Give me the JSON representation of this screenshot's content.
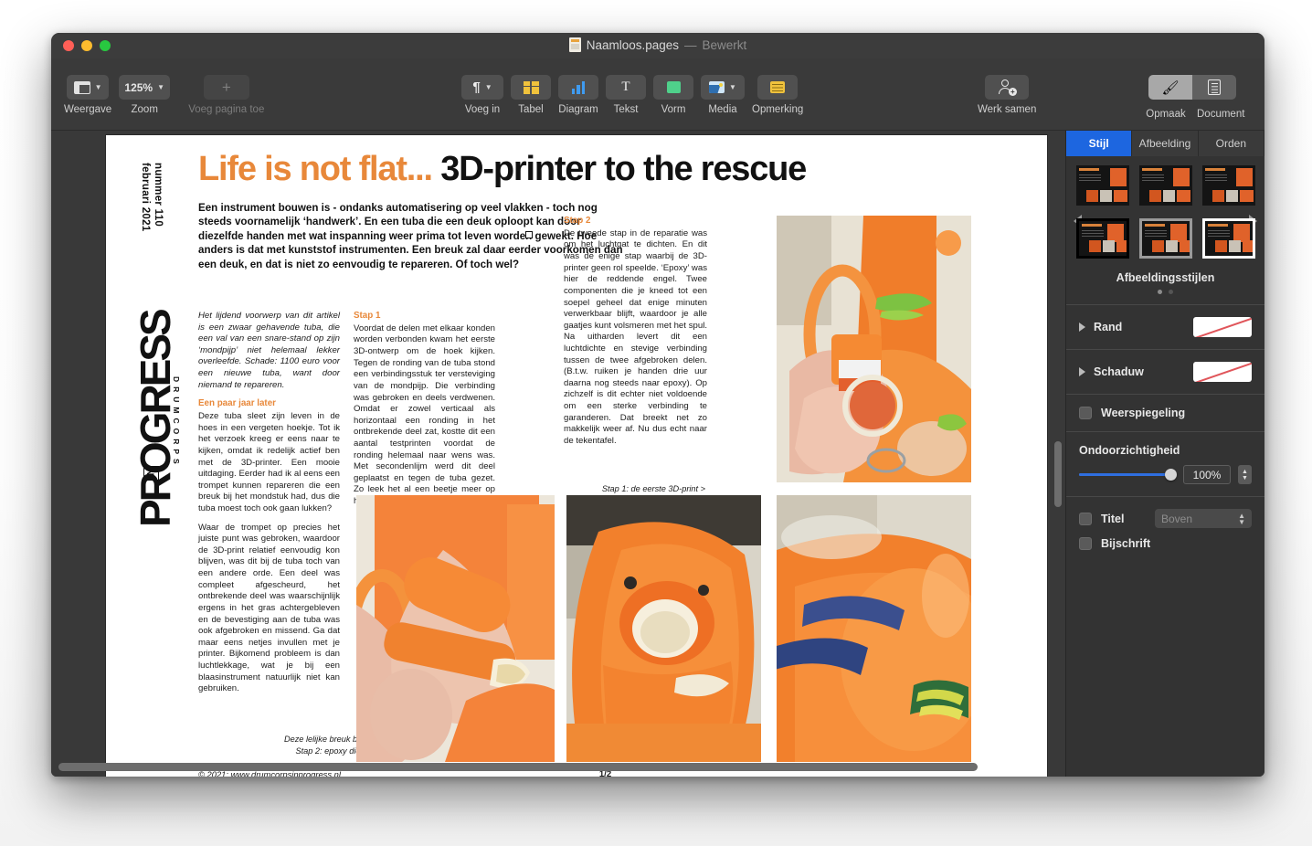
{
  "window": {
    "title_filename": "Naamloos.pages",
    "title_separator": "—",
    "title_state": "Bewerkt",
    "traffic_lights": [
      "close",
      "minimize",
      "zoom"
    ]
  },
  "toolbar": {
    "view_label": "Weergave",
    "zoom_label": "Zoom",
    "zoom_value": "125%",
    "add_page_label": "Voeg pagina toe",
    "insert_label": "Voeg in",
    "table_label": "Tabel",
    "chart_label": "Diagram",
    "text_label": "Tekst",
    "shape_label": "Vorm",
    "media_label": "Media",
    "comment_label": "Opmerking",
    "collaborate_label": "Werk samen",
    "format_label": "Opmaak",
    "document_label": "Document"
  },
  "inspector": {
    "tabs": [
      {
        "label": "Stijl",
        "active": true
      },
      {
        "label": "Afbeelding",
        "active": false
      },
      {
        "label": "Orden",
        "active": false
      }
    ],
    "styles_title": "Afbeeldingsstijlen",
    "border_label": "Rand",
    "shadow_label": "Schaduw",
    "reflection_label": "Weerspiegeling",
    "opacity_label": "Ondoorzichtigheid",
    "opacity_value": "100%",
    "title_checkbox_label": "Titel",
    "title_position_value": "Boven",
    "caption_checkbox_label": "Bijschrift",
    "accent_color": "#1d66e0"
  },
  "document": {
    "issue_line": "nummer 110\nfebruari 2021",
    "headline_orange": "Life is not flat...",
    "headline_black": "3D-printer to the rescue",
    "lede": "Een instrument bouwen is - ondanks automatisering op veel vlakken - toch nog steeds voornamelijk ‘handwerk’. En een tuba die een deuk oploopt kan door diezelfde handen met wat inspanning weer prima tot leven worden gewekt. Hoe anders is dat met kunststof instrumenten. Een breuk zal daar eerder voorkomen dan een deuk, en dat is niet zo eenvoudig te repareren. Of toch wel?",
    "logo": {
      "top_text": "DRUMCORPS",
      "big_text": "PROGRESS",
      "badge_text": "IN"
    },
    "column1": {
      "intro_italic": "Het lijdend voorwerp van dit artikel is een zwaar gehavende tuba, die een val van een snare-stand op zijn ‘mondpijp’ niet helemaal lekker overleefde. Schade: 1100 euro voor een nieuwe tuba, want door niemand te repareren.",
      "heading": "Een paar jaar later",
      "para1": "Deze tuba sleet zijn leven in de hoes in een vergeten hoekje. Tot ik het verzoek kreeg er eens naar te kijken, omdat ik redelijk actief ben met de 3D-printer. Een mooie uitdaging. Eerder had ik al eens een trompet kunnen repareren die een breuk bij het mondstuk had, dus die tuba moest toch ook gaan lukken?",
      "para2": "Waar de trompet op precies het juiste punt was gebroken, waardoor de 3D-print relatief eenvoudig kon blijven, was dit bij de tuba toch van een andere orde. Een deel was compleet afgescheurd, het ontbrekende deel was waarschijnlijk ergens in het gras achtergebleven en de bevestiging aan de tuba was ook afgebroken en missend. Ga dat maar eens netjes invullen met je printer. Bijkomend probleem is dan luchtlekkage, wat je bij een blaasinstrument natuurlijk niet kan gebruiken."
    },
    "column2": {
      "heading": "Stap 1",
      "para1": "Voordat de delen met elkaar konden worden verbonden kwam het eerste 3D-ontwerp om de hoek kijken. Tegen de ronding van de tuba stond een verbindingsstuk ter versteviging van de mondpijp. Die verbinding was gebroken en deels verdwenen. Omdat er zowel verticaal als horizontaal een ronding in het ontbrekende deel zat, kostte dit een aantal testprinten voordat de ronding helemaal naar wens was. Met secondenlijm werd dit deel geplaatst en tegen de tuba gezet. Zo leek het al een beetje meer op hoe het ooit was."
    },
    "column3": {
      "heading": "Stap 2",
      "para1": "De tweede stap in de reparatie was om het luchtgat te dichten. En dit was de enige stap waarbij de 3D-printer geen rol speelde. ‘Epoxy’ was hier de reddende engel. Twee componenten die je kneed tot een soepel geheel dat enige minuten verwerkbaar blijft, waardoor je alle gaatjes kunt volsmeren met het spul. Na uitharden levert dit een luchtdichte en stevige verbinding tussen de twee afgebroken delen. (B.t.w. ruiken je handen drie uur daarna nog steeds naar epoxy). Op zichzelf is dit echter niet voldoende om een sterke verbinding te garanderen. Dat breekt net zo makkelijk weer af. Nu dus echt naar de tekentafel."
    },
    "caption_1": "Stap 1: de eerste 3D-print >",
    "caption_2_line1": "Deze lelijke breuk bleek een uitdaging >>",
    "caption_2_line2": "Stap 2: epoxy dicht het eerste gat >>>",
    "footer_copyright": "© 2021: www.drumcorpsinprogress.nl",
    "footer_page": "1/2",
    "accent_orange": "#e8883a"
  }
}
